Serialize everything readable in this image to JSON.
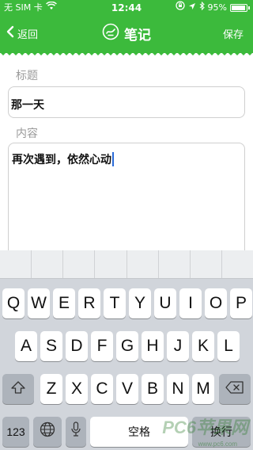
{
  "status_bar": {
    "carrier": "无 SIM 卡",
    "time": "12:44",
    "battery_text": "95%",
    "battery_level": 0.95
  },
  "nav": {
    "back_label": "返回",
    "title": "笔记",
    "save_label": "保存"
  },
  "form": {
    "title_label": "标题",
    "title_value": "那一天",
    "content_label": "内容",
    "content_value": "再次遇到，依然心动"
  },
  "keyboard": {
    "row1": [
      "Q",
      "W",
      "E",
      "R",
      "T",
      "Y",
      "U",
      "I",
      "O",
      "P"
    ],
    "row2": [
      "A",
      "S",
      "D",
      "F",
      "G",
      "H",
      "J",
      "K",
      "L"
    ],
    "row3": [
      "Z",
      "X",
      "C",
      "V",
      "B",
      "N",
      "M"
    ],
    "numbers_label": "123",
    "space_label": "空格",
    "return_label": "换行"
  },
  "watermark": {
    "text": "PC6苹果网",
    "url": "www.pc6.com"
  },
  "colors": {
    "accent": "#3cba3c",
    "cursor": "#2a6bd8"
  }
}
